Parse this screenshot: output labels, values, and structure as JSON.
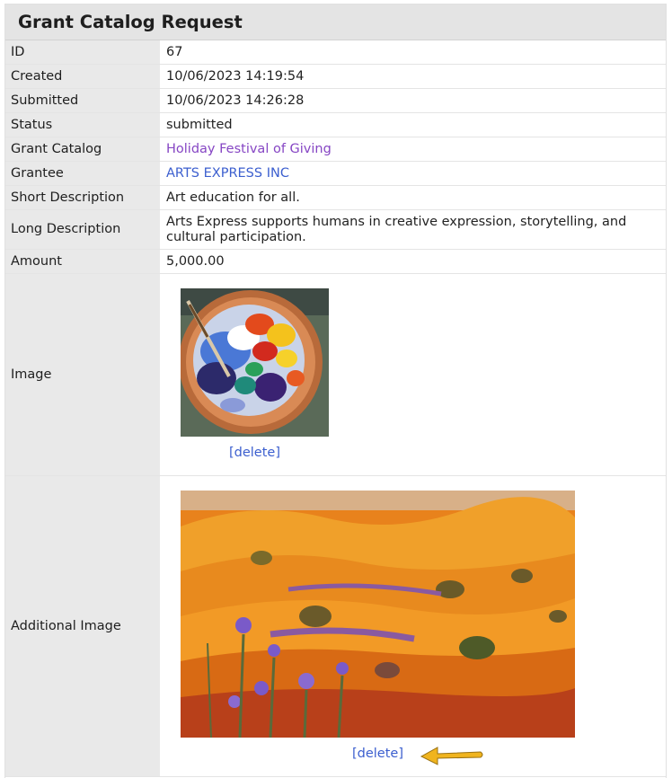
{
  "page": {
    "title": "Grant Catalog Request"
  },
  "fields": {
    "id": {
      "label": "ID",
      "value": "67"
    },
    "created": {
      "label": "Created",
      "value": "10/06/2023 14:19:54"
    },
    "submitted": {
      "label": "Submitted",
      "value": "10/06/2023 14:26:28"
    },
    "status": {
      "label": "Status",
      "value": "submitted"
    },
    "grant_catalog": {
      "label": "Grant Catalog",
      "value": "Holiday Festival of Giving"
    },
    "grantee": {
      "label": "Grantee",
      "value": "ARTS EXPRESS INC"
    },
    "short_description": {
      "label": "Short Description",
      "value": "Art education for all."
    },
    "long_description": {
      "label": "Long Description",
      "value": "Arts Express supports humans in creative expression, storytelling, and cultural participation."
    },
    "amount": {
      "label": "Amount",
      "value": "5,000.00"
    },
    "image": {
      "label": "Image",
      "delete_label": "[delete]"
    },
    "additional_image": {
      "label": "Additional Image",
      "delete_label": "[delete]"
    }
  },
  "colors": {
    "link_purple": "#8646c4",
    "link_blue": "#3c5fcf",
    "label_bg": "#e9e9e9",
    "title_bg": "#e4e4e4",
    "arrow": "#f0b41e"
  },
  "icons": {
    "annotation_arrow": "arrow-left-icon"
  }
}
